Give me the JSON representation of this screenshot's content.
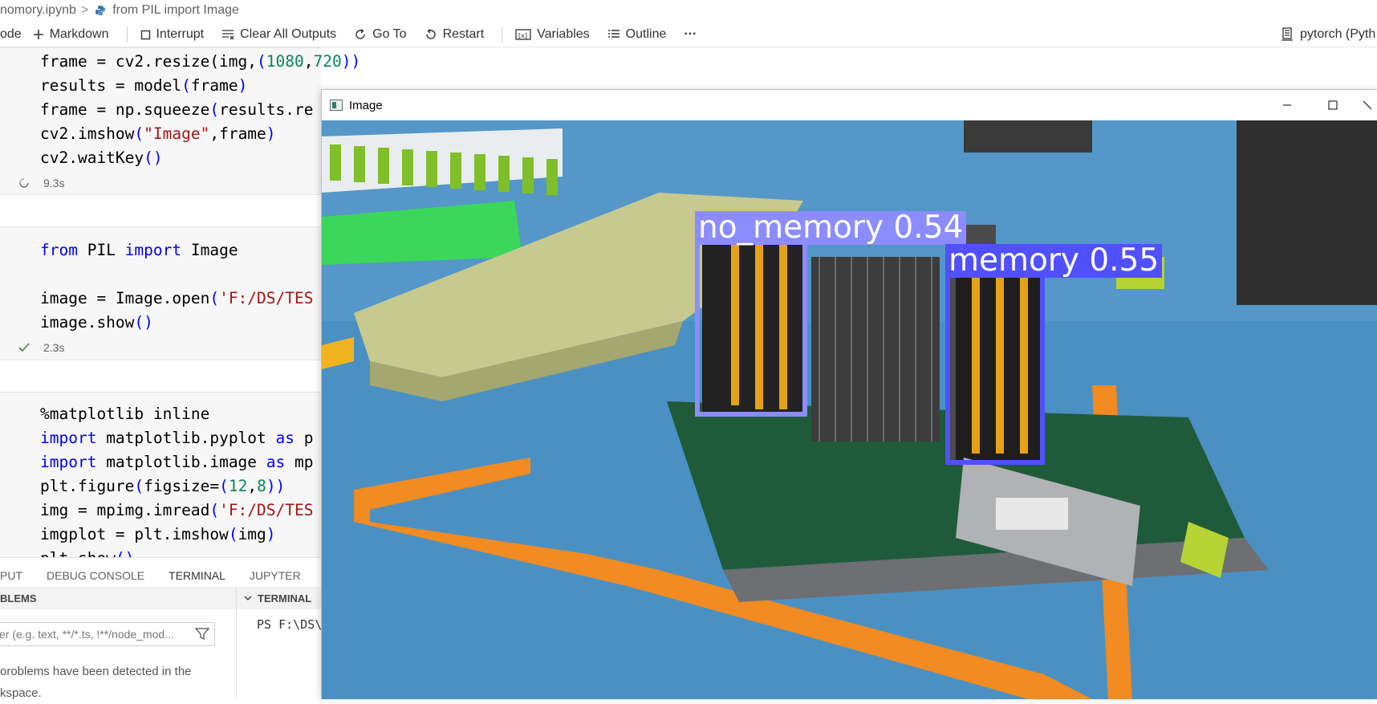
{
  "breadcrumb": {
    "file": "nomory.ipynb",
    "separator": ">",
    "cell": "from PIL import Image"
  },
  "toolbar": {
    "code_label": "ode",
    "markdown_label": "Markdown",
    "interrupt_label": "Interrupt",
    "clear_label": "Clear All Outputs",
    "goto_label": "Go To",
    "restart_label": "Restart",
    "variables_label": "Variables",
    "outline_label": "Outline",
    "more_label": "···",
    "kernel_label": "pytorch (Pyth"
  },
  "cells": [
    {
      "time": "9.3s",
      "state": "running"
    },
    {
      "time": "2.3s",
      "state": "success"
    }
  ],
  "panel": {
    "tabs": [
      "PUT",
      "DEBUG CONSOLE",
      "TERMINAL",
      "JUPYTER"
    ],
    "active_tab": "TERMINAL",
    "problems_header": "BLEMS",
    "terminal_header": "TERMINAL",
    "filter_placeholder": "er (e.g. text, **/*.ts, !**/node_mod...",
    "problems_line1": "oroblems have been detected in the",
    "problems_line2": "kspace.",
    "terminal_prompt": "PS F:\\DS\\"
  },
  "image_window": {
    "title": "Image",
    "detections": [
      {
        "label": "no_memory  0.54",
        "class": "no_memory",
        "confidence": 0.54,
        "color": "#8c8cff"
      },
      {
        "label": "memory  0.55",
        "class": "memory",
        "confidence": 0.55,
        "color": "#5050ff"
      }
    ]
  },
  "colors": {
    "keyword": "#0000ff",
    "string": "#a31515",
    "number": "#098658",
    "accent": "#007acc"
  }
}
